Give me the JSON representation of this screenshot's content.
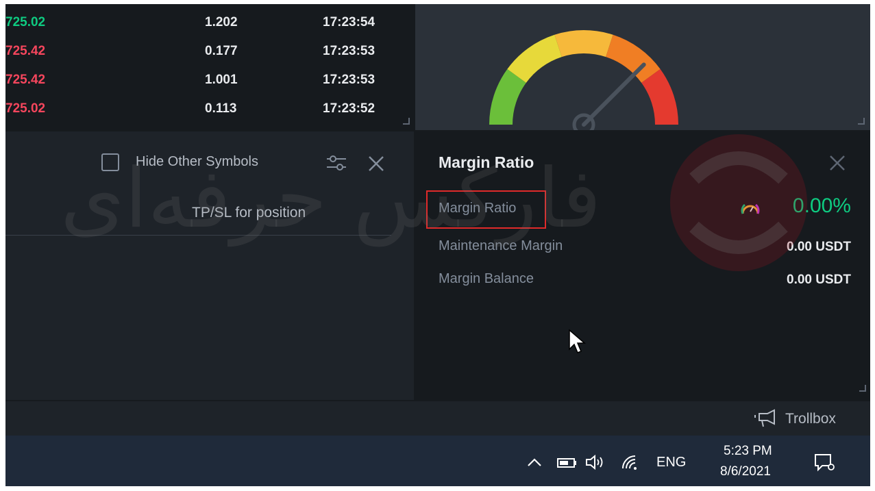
{
  "trades": [
    {
      "price": "725.02",
      "price_color": "#0ecb81",
      "qty": "1.202",
      "time": "17:23:54"
    },
    {
      "price": "725.42",
      "price_color": "#f6465d",
      "qty": "0.177",
      "time": "17:23:53"
    },
    {
      "price": "725.42",
      "price_color": "#f6465d",
      "qty": "1.001",
      "time": "17:23:53"
    },
    {
      "price": "725.02",
      "price_color": "#f6465d",
      "qty": "0.113",
      "time": "17:23:52"
    }
  ],
  "positions": {
    "hide_other_symbols_label": "Hide Other Symbols",
    "hide_other_symbols_checked": false,
    "tab_tpsl": "TP/SL for position"
  },
  "margin_ratio": {
    "title": "Margin Ratio",
    "rows": [
      {
        "label": "Margin Ratio",
        "value": "0.00%"
      },
      {
        "label": "Maintenance Margin",
        "value": "0.00 USDT"
      },
      {
        "label": "Margin Balance",
        "value": "0.00 USDT"
      }
    ]
  },
  "gauge": {
    "segment_colors": [
      "#6bbf3a",
      "#e7d93a",
      "#f6b93b",
      "#f07e24",
      "#e43a2f"
    ],
    "needle_level": 0.75
  },
  "trollbox": {
    "label": "Trollbox"
  },
  "taskbar": {
    "language": "ENG",
    "time": "5:23 PM",
    "date": "8/6/2021"
  },
  "watermark_text": "فارکس حرفه‌ای",
  "colors": {
    "accent_green": "#0ecb81",
    "accent_red": "#f6465d",
    "highlight_border": "#e02a2a"
  }
}
